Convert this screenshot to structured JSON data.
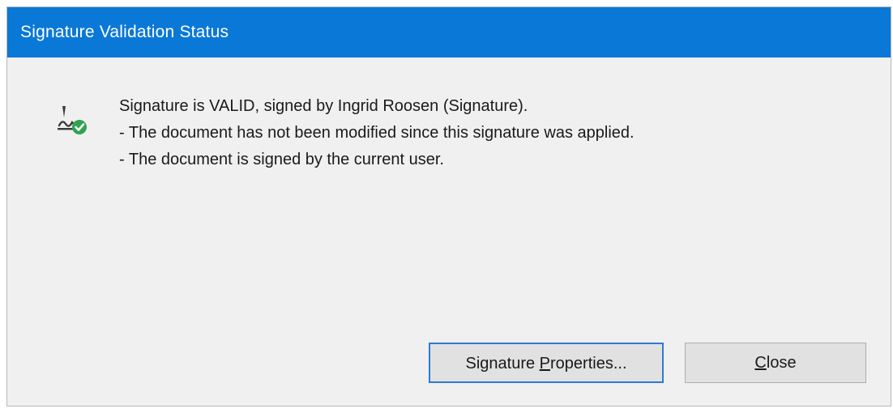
{
  "dialog": {
    "title": "Signature Validation Status",
    "icon": "signature-valid-icon",
    "message": {
      "line1": "Signature is VALID, signed by Ingrid Roosen (Signature).",
      "line2": "- The document has not been modified since this signature was applied.",
      "line3": "- The document is signed by the current user."
    },
    "buttons": {
      "properties": {
        "label_pre": "Signature ",
        "label_mnemonic": "P",
        "label_post": "roperties..."
      },
      "close": {
        "label_mnemonic": "C",
        "label_post": "lose"
      }
    }
  },
  "colors": {
    "titlebar": "#0a78d7",
    "body": "#f0f0f0",
    "focus_border": "#2b7bd4",
    "check_green": "#2ea44f"
  }
}
